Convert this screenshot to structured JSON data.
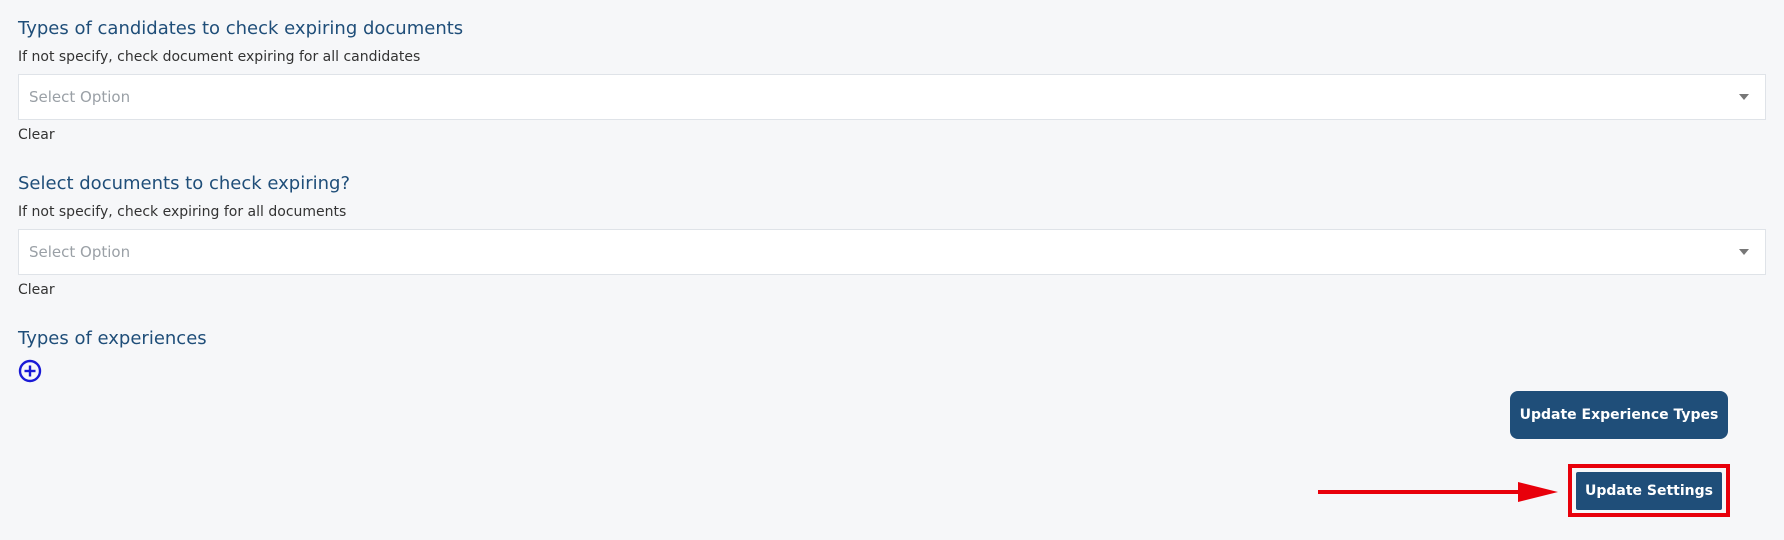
{
  "sections": [
    {
      "title": "Types of candidates to check expiring documents",
      "help": "If not specify, check document expiring for all candidates",
      "placeholder": "Select Option",
      "clear_label": "Clear"
    },
    {
      "title": "Select documents to check expiring?",
      "help": "If not specify, check expiring for all documents",
      "placeholder": "Select Option",
      "clear_label": "Clear"
    }
  ],
  "experiences": {
    "title": "Types of experiences",
    "add_icon": "plus-circle-icon"
  },
  "buttons": {
    "update_experience_types": "Update Experience Types",
    "update_settings": "Update Settings"
  },
  "annotation": {
    "highlight_color": "#e8000b",
    "arrow_icon": "red-arrow-right"
  },
  "colors": {
    "primary": "#1f4e79",
    "background": "#f6f7f9",
    "add_icon": "#1a1ad6"
  }
}
